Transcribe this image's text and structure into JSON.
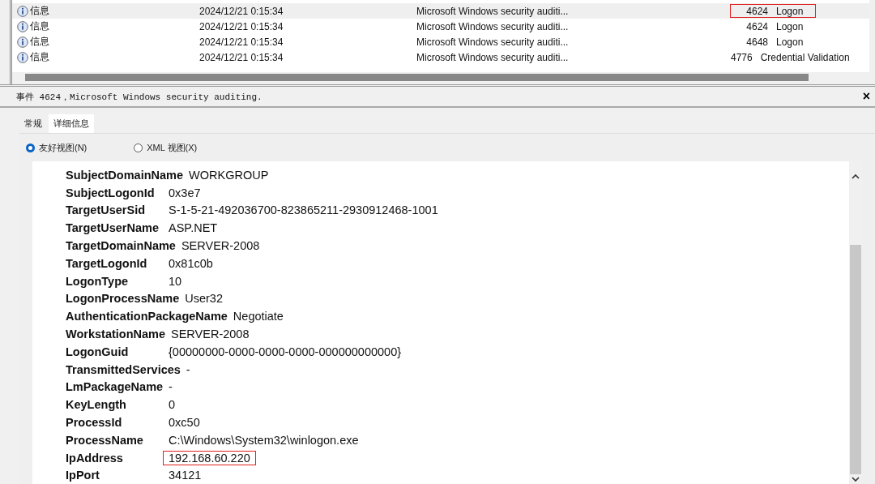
{
  "event_list": {
    "rows": [
      {
        "level": "信息",
        "date": "2024/12/21 0:15:34",
        "source": "Microsoft Windows security auditi...",
        "event_id": "4624",
        "category": "Logon",
        "selected": true,
        "highlighted": true
      },
      {
        "level": "信息",
        "date": "2024/12/21 0:15:34",
        "source": "Microsoft Windows security auditi...",
        "event_id": "4624",
        "category": "Logon",
        "selected": false,
        "highlighted": false
      },
      {
        "level": "信息",
        "date": "2024/12/21 0:15:34",
        "source": "Microsoft Windows security auditi...",
        "event_id": "4648",
        "category": "Logon",
        "selected": false,
        "highlighted": false
      },
      {
        "level": "信息",
        "date": "2024/12/21 0:15:34",
        "source": "Microsoft Windows security auditi...",
        "event_id": "4776",
        "category": "Credential Validation",
        "selected": false,
        "highlighted": false
      }
    ]
  },
  "detail_panel": {
    "title": "事件 4624，Microsoft Windows security auditing.",
    "close": "×",
    "tabs": [
      {
        "label": "常规",
        "selected": false
      },
      {
        "label": "详细信息",
        "selected": true
      }
    ],
    "view_options": [
      {
        "label": "友好视图(N)",
        "selected": true
      },
      {
        "label": "XML 视图(X)",
        "selected": false
      }
    ],
    "fields": [
      {
        "name": "SubjectDomainName",
        "value": "WORKGROUP",
        "highlighted": false
      },
      {
        "name": "SubjectLogonId",
        "value": "0x3e7",
        "highlighted": false
      },
      {
        "name": "TargetUserSid",
        "value": "S-1-5-21-492036700-823865211-2930912468-1001",
        "highlighted": false
      },
      {
        "name": "TargetUserName",
        "value": "ASP.NET",
        "highlighted": false
      },
      {
        "name": "TargetDomainName",
        "value": "SERVER-2008",
        "highlighted": false
      },
      {
        "name": "TargetLogonId",
        "value": "0x81c0b",
        "highlighted": false
      },
      {
        "name": "LogonType",
        "value": "10",
        "highlighted": false
      },
      {
        "name": "LogonProcessName",
        "value": "User32",
        "highlighted": false
      },
      {
        "name": "AuthenticationPackageName",
        "value": "Negotiate",
        "highlighted": false
      },
      {
        "name": "WorkstationName",
        "value": "SERVER-2008",
        "highlighted": false
      },
      {
        "name": "LogonGuid",
        "value": "{00000000-0000-0000-0000-000000000000}",
        "highlighted": false
      },
      {
        "name": "TransmittedServices",
        "value": "-",
        "highlighted": false
      },
      {
        "name": "LmPackageName",
        "value": "-",
        "highlighted": false
      },
      {
        "name": "KeyLength",
        "value": "0",
        "highlighted": false
      },
      {
        "name": "ProcessId",
        "value": "0xc50",
        "highlighted": false
      },
      {
        "name": "ProcessName",
        "value": "C:\\Windows\\System32\\winlogon.exe",
        "highlighted": false
      },
      {
        "name": "IpAddress",
        "value": "192.168.60.220",
        "highlighted": true
      },
      {
        "name": "IpPort",
        "value": "34121",
        "highlighted": false
      }
    ]
  }
}
